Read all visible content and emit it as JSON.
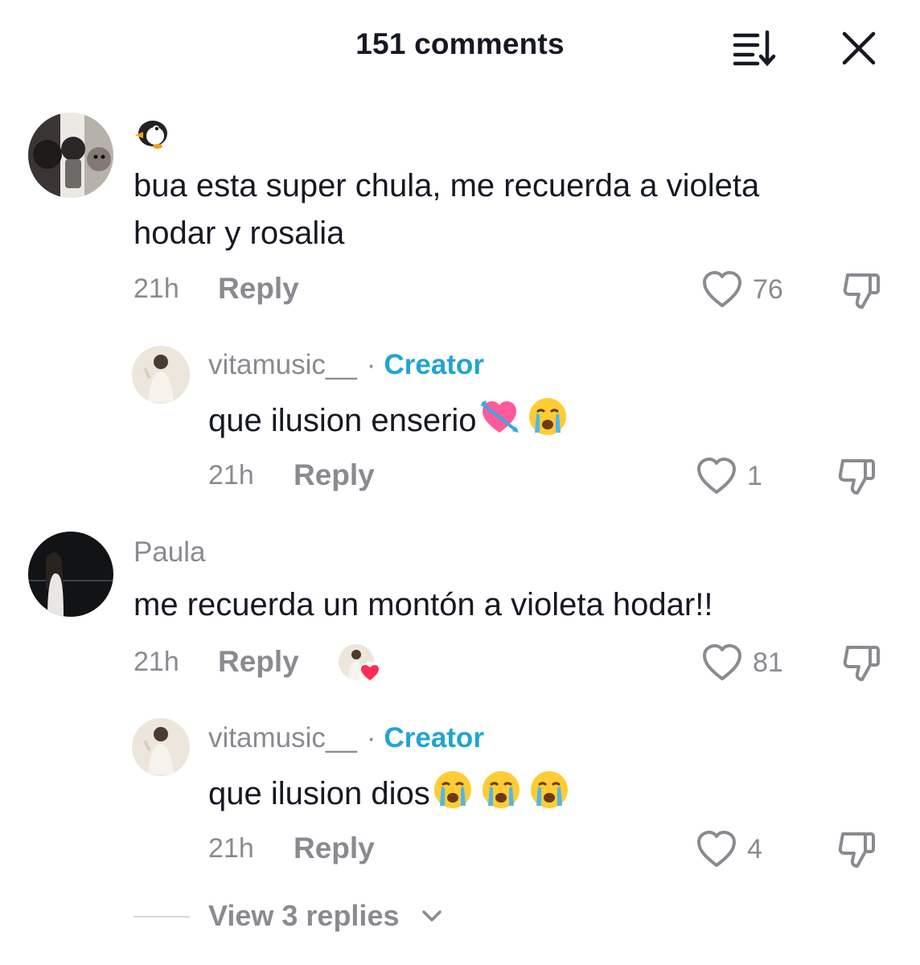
{
  "header": {
    "title": "151 comments",
    "sort_icon": "sort-icon",
    "close_icon": "close-icon"
  },
  "comments": [
    {
      "username": "🐧",
      "text_line1": "bua esta super chula, me recuerda a violeta",
      "text_line2": "hodar y rosalia",
      "time": "21h",
      "reply_label": "Reply",
      "likes": "76",
      "reply": {
        "username": "vitamusic__",
        "separator": "·",
        "badge": "Creator",
        "text": "que ilusion enserio",
        "emojis": [
          "💘",
          "😭"
        ],
        "time": "21h",
        "reply_label": "Reply",
        "likes": "1"
      }
    },
    {
      "username": "Paula",
      "text_line1": "me recuerda un montón a violeta hodar!!",
      "time": "21h",
      "reply_label": "Reply",
      "likes": "81",
      "creator_liked": true,
      "reply": {
        "username": "vitamusic__",
        "separator": "·",
        "badge": "Creator",
        "text": "que ilusion dios",
        "emojis": [
          "😭",
          "😭",
          "😭"
        ],
        "time": "21h",
        "reply_label": "Reply",
        "likes": "4"
      }
    }
  ],
  "view_replies": "View 3 replies",
  "colors": {
    "text": "#161823",
    "muted": "#8a8b91",
    "creator": "#20a5d2",
    "heart_red": "#fe2c55"
  }
}
